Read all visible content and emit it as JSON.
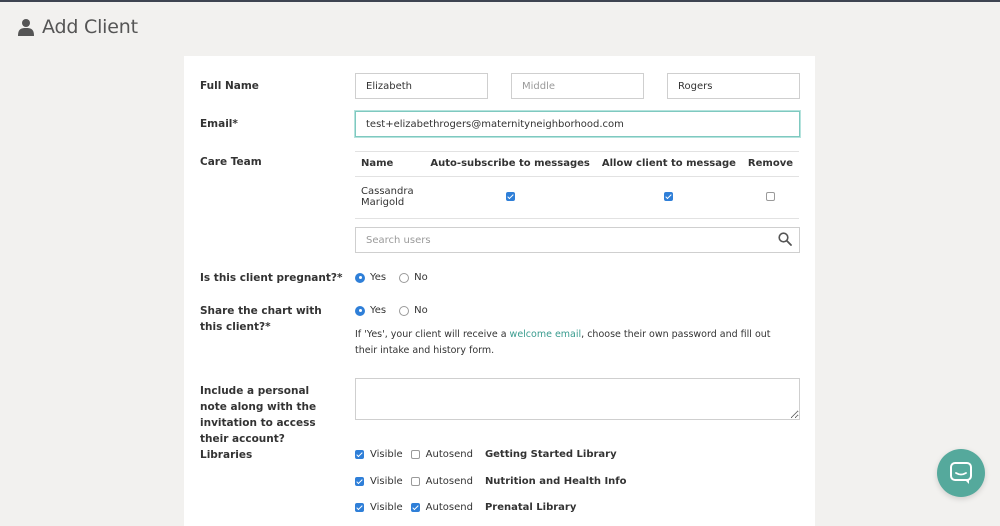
{
  "page": {
    "title": "Add Client",
    "icon": "user-icon"
  },
  "form": {
    "full_name": {
      "label": "Full Name",
      "first": {
        "value": "Elizabeth",
        "placeholder": ""
      },
      "middle": {
        "value": "",
        "placeholder": "Middle"
      },
      "last": {
        "value": "Rogers",
        "placeholder": ""
      }
    },
    "email": {
      "label": "Email*",
      "value": "test+elizabethrogers@maternityneighborhood.com"
    },
    "care_team": {
      "label": "Care Team",
      "columns": [
        "Name",
        "Auto-subscribe to messages",
        "Allow client to message",
        "Remove"
      ],
      "rows": [
        {
          "name": "Cassandra Marigold",
          "auto_subscribe": true,
          "allow_message": true,
          "remove": false
        }
      ],
      "search_placeholder": "Search users"
    },
    "pregnant": {
      "label": "Is this client pregnant?*",
      "yes": "Yes",
      "no": "No",
      "selected": "Yes"
    },
    "share_chart": {
      "label": "Share the chart with this client?*",
      "yes": "Yes",
      "no": "No",
      "selected": "Yes",
      "help_before": "If 'Yes', your client will receive a ",
      "help_link": "welcome email",
      "help_after": ", choose their own password and fill out their intake and history form."
    },
    "personal_note": {
      "label": "Include a personal note along with the invitation to access their account?",
      "value": ""
    },
    "libraries": {
      "label": "Libraries",
      "visible_label": "Visible",
      "autosend_label": "Autosend",
      "items": [
        {
          "name": "Getting Started Library",
          "visible": true,
          "autosend": false
        },
        {
          "name": "Nutrition and Health Info",
          "visible": true,
          "autosend": false
        },
        {
          "name": "Prenatal Library",
          "visible": true,
          "autosend": true
        }
      ]
    }
  },
  "chat": {
    "icon": "chat-icon"
  },
  "colors": {
    "accent": "#55a99c",
    "checkbox": "#2f7fd8",
    "link": "#3a9c8f",
    "background": "#f2f1ef"
  }
}
